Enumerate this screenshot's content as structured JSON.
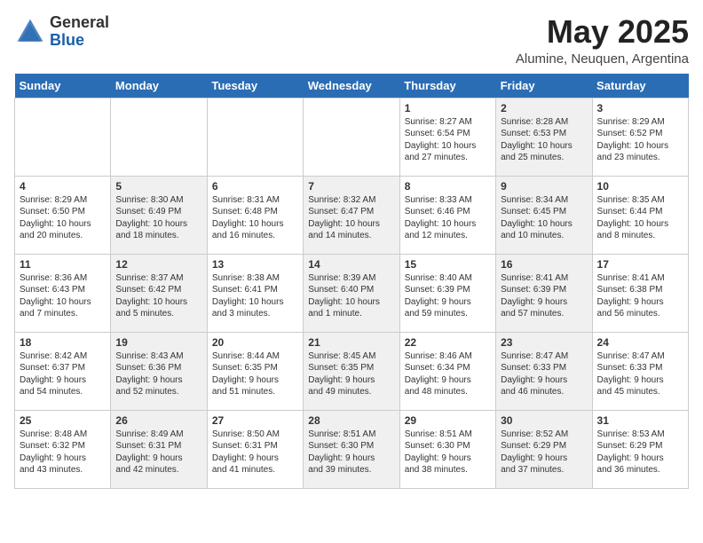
{
  "header": {
    "logo_general": "General",
    "logo_blue": "Blue",
    "month": "May 2025",
    "location": "Alumine, Neuquen, Argentina"
  },
  "days_of_week": [
    "Sunday",
    "Monday",
    "Tuesday",
    "Wednesday",
    "Thursday",
    "Friday",
    "Saturday"
  ],
  "weeks": [
    [
      {
        "day": "",
        "info": "",
        "shaded": false
      },
      {
        "day": "",
        "info": "",
        "shaded": false
      },
      {
        "day": "",
        "info": "",
        "shaded": false
      },
      {
        "day": "",
        "info": "",
        "shaded": false
      },
      {
        "day": "1",
        "info": "Sunrise: 8:27 AM\nSunset: 6:54 PM\nDaylight: 10 hours\nand 27 minutes.",
        "shaded": false
      },
      {
        "day": "2",
        "info": "Sunrise: 8:28 AM\nSunset: 6:53 PM\nDaylight: 10 hours\nand 25 minutes.",
        "shaded": true
      },
      {
        "day": "3",
        "info": "Sunrise: 8:29 AM\nSunset: 6:52 PM\nDaylight: 10 hours\nand 23 minutes.",
        "shaded": false
      }
    ],
    [
      {
        "day": "4",
        "info": "Sunrise: 8:29 AM\nSunset: 6:50 PM\nDaylight: 10 hours\nand 20 minutes.",
        "shaded": false
      },
      {
        "day": "5",
        "info": "Sunrise: 8:30 AM\nSunset: 6:49 PM\nDaylight: 10 hours\nand 18 minutes.",
        "shaded": true
      },
      {
        "day": "6",
        "info": "Sunrise: 8:31 AM\nSunset: 6:48 PM\nDaylight: 10 hours\nand 16 minutes.",
        "shaded": false
      },
      {
        "day": "7",
        "info": "Sunrise: 8:32 AM\nSunset: 6:47 PM\nDaylight: 10 hours\nand 14 minutes.",
        "shaded": true
      },
      {
        "day": "8",
        "info": "Sunrise: 8:33 AM\nSunset: 6:46 PM\nDaylight: 10 hours\nand 12 minutes.",
        "shaded": false
      },
      {
        "day": "9",
        "info": "Sunrise: 8:34 AM\nSunset: 6:45 PM\nDaylight: 10 hours\nand 10 minutes.",
        "shaded": true
      },
      {
        "day": "10",
        "info": "Sunrise: 8:35 AM\nSunset: 6:44 PM\nDaylight: 10 hours\nand 8 minutes.",
        "shaded": false
      }
    ],
    [
      {
        "day": "11",
        "info": "Sunrise: 8:36 AM\nSunset: 6:43 PM\nDaylight: 10 hours\nand 7 minutes.",
        "shaded": false
      },
      {
        "day": "12",
        "info": "Sunrise: 8:37 AM\nSunset: 6:42 PM\nDaylight: 10 hours\nand 5 minutes.",
        "shaded": true
      },
      {
        "day": "13",
        "info": "Sunrise: 8:38 AM\nSunset: 6:41 PM\nDaylight: 10 hours\nand 3 minutes.",
        "shaded": false
      },
      {
        "day": "14",
        "info": "Sunrise: 8:39 AM\nSunset: 6:40 PM\nDaylight: 10 hours\nand 1 minute.",
        "shaded": true
      },
      {
        "day": "15",
        "info": "Sunrise: 8:40 AM\nSunset: 6:39 PM\nDaylight: 9 hours\nand 59 minutes.",
        "shaded": false
      },
      {
        "day": "16",
        "info": "Sunrise: 8:41 AM\nSunset: 6:39 PM\nDaylight: 9 hours\nand 57 minutes.",
        "shaded": true
      },
      {
        "day": "17",
        "info": "Sunrise: 8:41 AM\nSunset: 6:38 PM\nDaylight: 9 hours\nand 56 minutes.",
        "shaded": false
      }
    ],
    [
      {
        "day": "18",
        "info": "Sunrise: 8:42 AM\nSunset: 6:37 PM\nDaylight: 9 hours\nand 54 minutes.",
        "shaded": false
      },
      {
        "day": "19",
        "info": "Sunrise: 8:43 AM\nSunset: 6:36 PM\nDaylight: 9 hours\nand 52 minutes.",
        "shaded": true
      },
      {
        "day": "20",
        "info": "Sunrise: 8:44 AM\nSunset: 6:35 PM\nDaylight: 9 hours\nand 51 minutes.",
        "shaded": false
      },
      {
        "day": "21",
        "info": "Sunrise: 8:45 AM\nSunset: 6:35 PM\nDaylight: 9 hours\nand 49 minutes.",
        "shaded": true
      },
      {
        "day": "22",
        "info": "Sunrise: 8:46 AM\nSunset: 6:34 PM\nDaylight: 9 hours\nand 48 minutes.",
        "shaded": false
      },
      {
        "day": "23",
        "info": "Sunrise: 8:47 AM\nSunset: 6:33 PM\nDaylight: 9 hours\nand 46 minutes.",
        "shaded": true
      },
      {
        "day": "24",
        "info": "Sunrise: 8:47 AM\nSunset: 6:33 PM\nDaylight: 9 hours\nand 45 minutes.",
        "shaded": false
      }
    ],
    [
      {
        "day": "25",
        "info": "Sunrise: 8:48 AM\nSunset: 6:32 PM\nDaylight: 9 hours\nand 43 minutes.",
        "shaded": false
      },
      {
        "day": "26",
        "info": "Sunrise: 8:49 AM\nSunset: 6:31 PM\nDaylight: 9 hours\nand 42 minutes.",
        "shaded": true
      },
      {
        "day": "27",
        "info": "Sunrise: 8:50 AM\nSunset: 6:31 PM\nDaylight: 9 hours\nand 41 minutes.",
        "shaded": false
      },
      {
        "day": "28",
        "info": "Sunrise: 8:51 AM\nSunset: 6:30 PM\nDaylight: 9 hours\nand 39 minutes.",
        "shaded": true
      },
      {
        "day": "29",
        "info": "Sunrise: 8:51 AM\nSunset: 6:30 PM\nDaylight: 9 hours\nand 38 minutes.",
        "shaded": false
      },
      {
        "day": "30",
        "info": "Sunrise: 8:52 AM\nSunset: 6:29 PM\nDaylight: 9 hours\nand 37 minutes.",
        "shaded": true
      },
      {
        "day": "31",
        "info": "Sunrise: 8:53 AM\nSunset: 6:29 PM\nDaylight: 9 hours\nand 36 minutes.",
        "shaded": false
      }
    ]
  ]
}
